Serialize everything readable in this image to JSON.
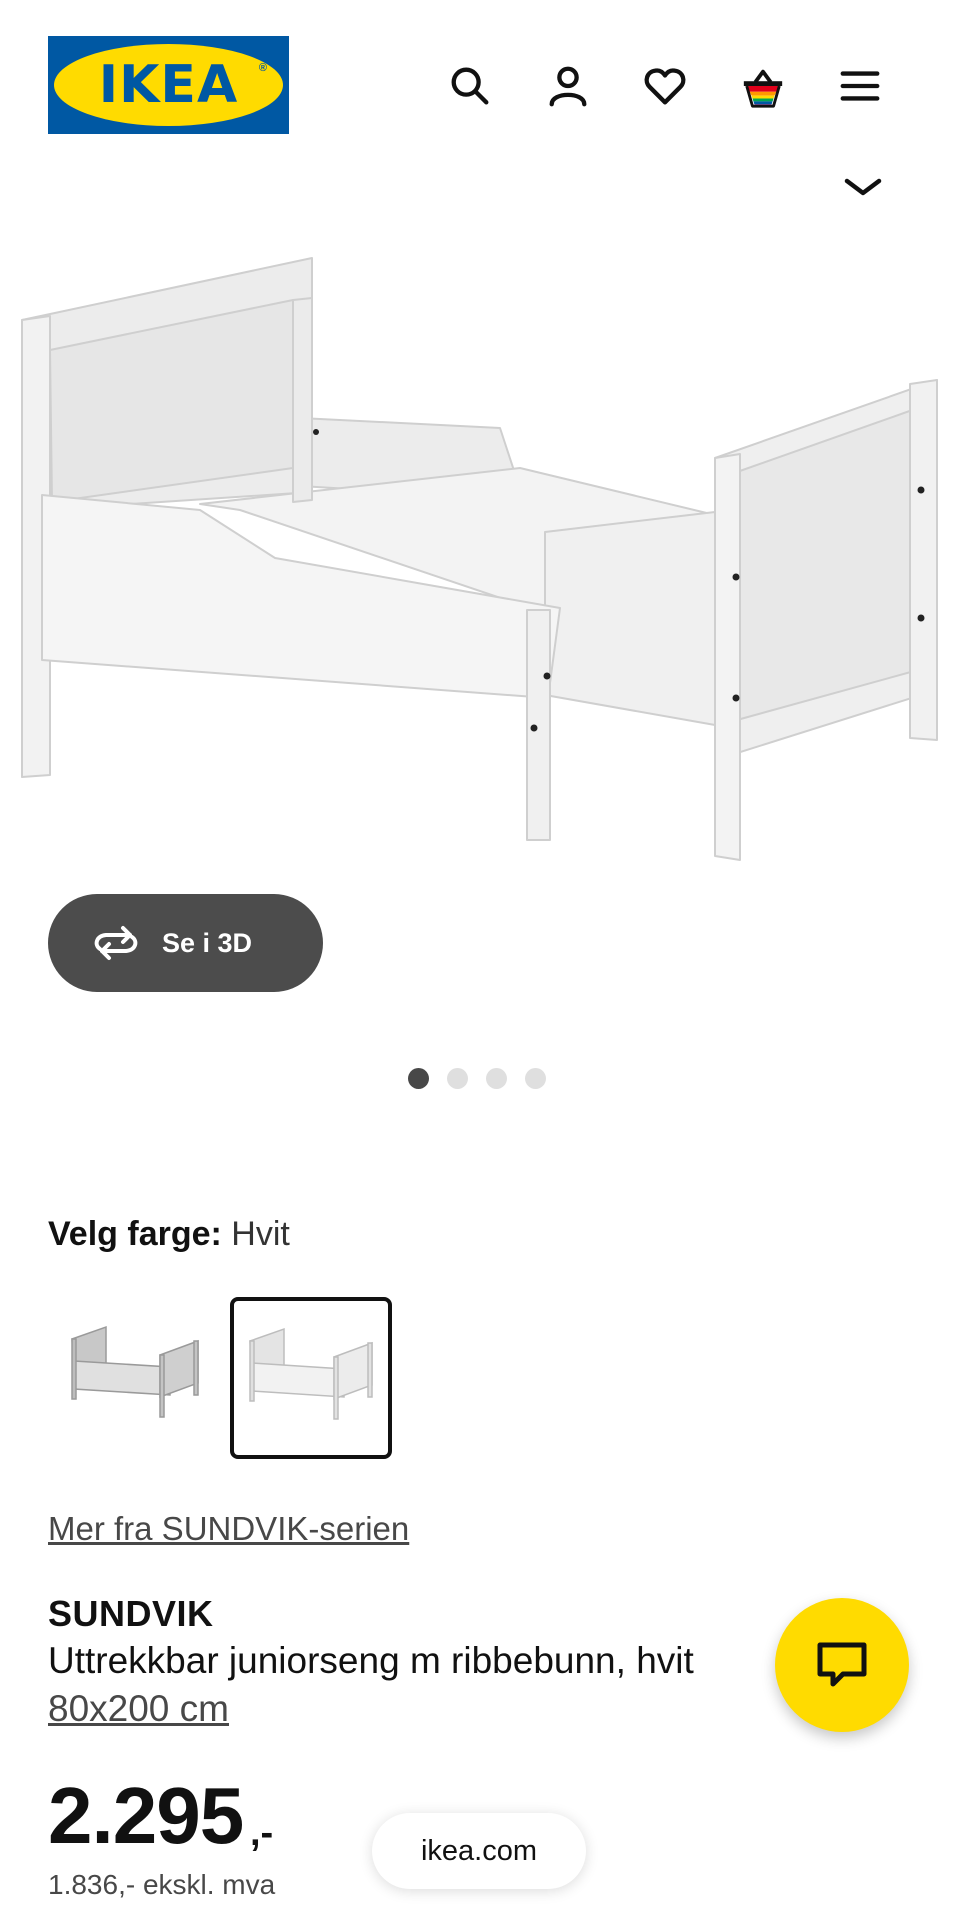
{
  "header": {
    "logo_text": "IKEA",
    "logo_mark": "®",
    "icons": [
      "search-icon",
      "account-icon",
      "heart-icon",
      "basket-icon",
      "menu-icon"
    ],
    "brand_colors": {
      "blue": "#0058a3",
      "yellow": "#ffdb00"
    }
  },
  "gallery": {
    "view_3d_label": "Se i 3D",
    "slide_count": 4,
    "active_slide": 1
  },
  "color": {
    "label": "Velg farge:",
    "value": "Hvit",
    "swatches": [
      {
        "selected": false,
        "tone": "grey"
      },
      {
        "selected": true,
        "tone": "white"
      }
    ]
  },
  "series_link": "Mer fra SUNDVIK-serien",
  "product": {
    "name": "SUNDVIK",
    "description": "Uttrekkbar juniorseng m ribbebunn, hvit",
    "size_link": "80x200 cm",
    "price": "2.295",
    "price_suffix": ",-",
    "price_ex_vat": "1.836,- ekskl. mva"
  },
  "browser": {
    "domain": "ikea.com"
  },
  "chat": {
    "icon": "chat-icon",
    "color": "#ffdb00"
  }
}
